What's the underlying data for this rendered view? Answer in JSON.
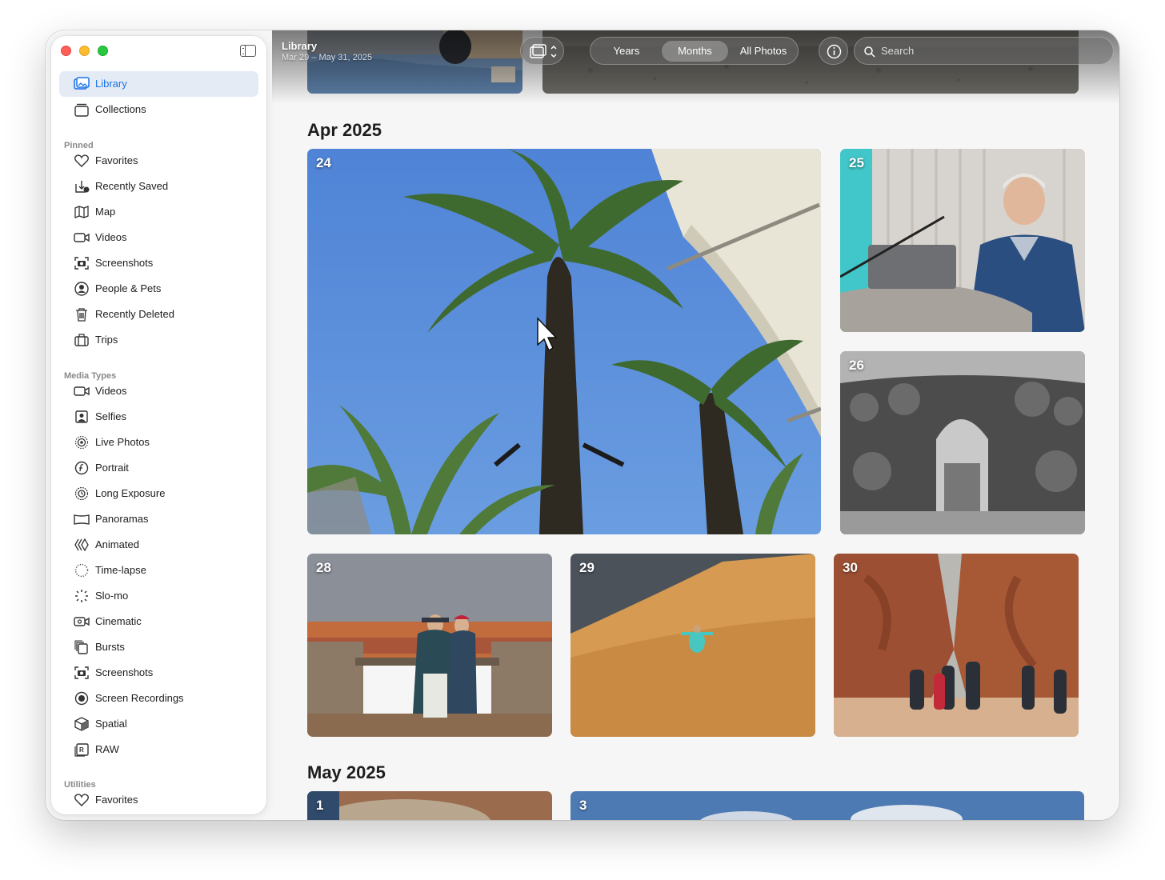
{
  "window": {
    "title": "Library",
    "date_range": "Mar 29 – May 31, 2025"
  },
  "toolbar": {
    "segments": [
      "Years",
      "Months",
      "All Photos"
    ],
    "active_segment": "Months",
    "search_placeholder": "Search"
  },
  "sidebar": {
    "top_items": [
      {
        "label": "Library",
        "icon": "photo-library-icon",
        "active": true
      },
      {
        "label": "Collections",
        "icon": "collections-icon",
        "active": false
      }
    ],
    "pinned_title": "Pinned",
    "pinned": [
      {
        "label": "Favorites",
        "icon": "heart-icon"
      },
      {
        "label": "Recently Saved",
        "icon": "recently-saved-icon"
      },
      {
        "label": "Map",
        "icon": "map-icon"
      },
      {
        "label": "Videos",
        "icon": "video-icon"
      },
      {
        "label": "Screenshots",
        "icon": "screenshot-icon"
      },
      {
        "label": "People & Pets",
        "icon": "person-circle-icon"
      },
      {
        "label": "Recently Deleted",
        "icon": "trash-icon"
      },
      {
        "label": "Trips",
        "icon": "suitcase-icon"
      }
    ],
    "media_title": "Media Types",
    "media_types": [
      {
        "label": "Videos",
        "icon": "video-icon"
      },
      {
        "label": "Selfies",
        "icon": "selfie-icon"
      },
      {
        "label": "Live Photos",
        "icon": "live-photo-icon"
      },
      {
        "label": "Portrait",
        "icon": "portrait-f-icon"
      },
      {
        "label": "Long Exposure",
        "icon": "long-exposure-icon"
      },
      {
        "label": "Panoramas",
        "icon": "panorama-icon"
      },
      {
        "label": "Animated",
        "icon": "animated-icon"
      },
      {
        "label": "Time-lapse",
        "icon": "timelapse-icon"
      },
      {
        "label": "Slo-mo",
        "icon": "slomo-icon"
      },
      {
        "label": "Cinematic",
        "icon": "cinematic-icon"
      },
      {
        "label": "Bursts",
        "icon": "bursts-icon"
      },
      {
        "label": "Screenshots",
        "icon": "screenshot-icon"
      },
      {
        "label": "Screen Recordings",
        "icon": "screen-recording-icon"
      },
      {
        "label": "Spatial",
        "icon": "cube-icon"
      },
      {
        "label": "RAW",
        "icon": "raw-icon"
      }
    ],
    "utilities_title": "Utilities",
    "utilities": [
      {
        "label": "Favorites",
        "icon": "heart-icon"
      }
    ]
  },
  "months": [
    {
      "title": "Apr 2025",
      "days": [
        "24",
        "25",
        "26",
        "28",
        "29",
        "30"
      ]
    },
    {
      "title": "May 2025",
      "days": [
        "1",
        "3"
      ]
    }
  ],
  "colors": {
    "accent": "#1a73e8",
    "sidebar_active": "#e4ebf5"
  }
}
